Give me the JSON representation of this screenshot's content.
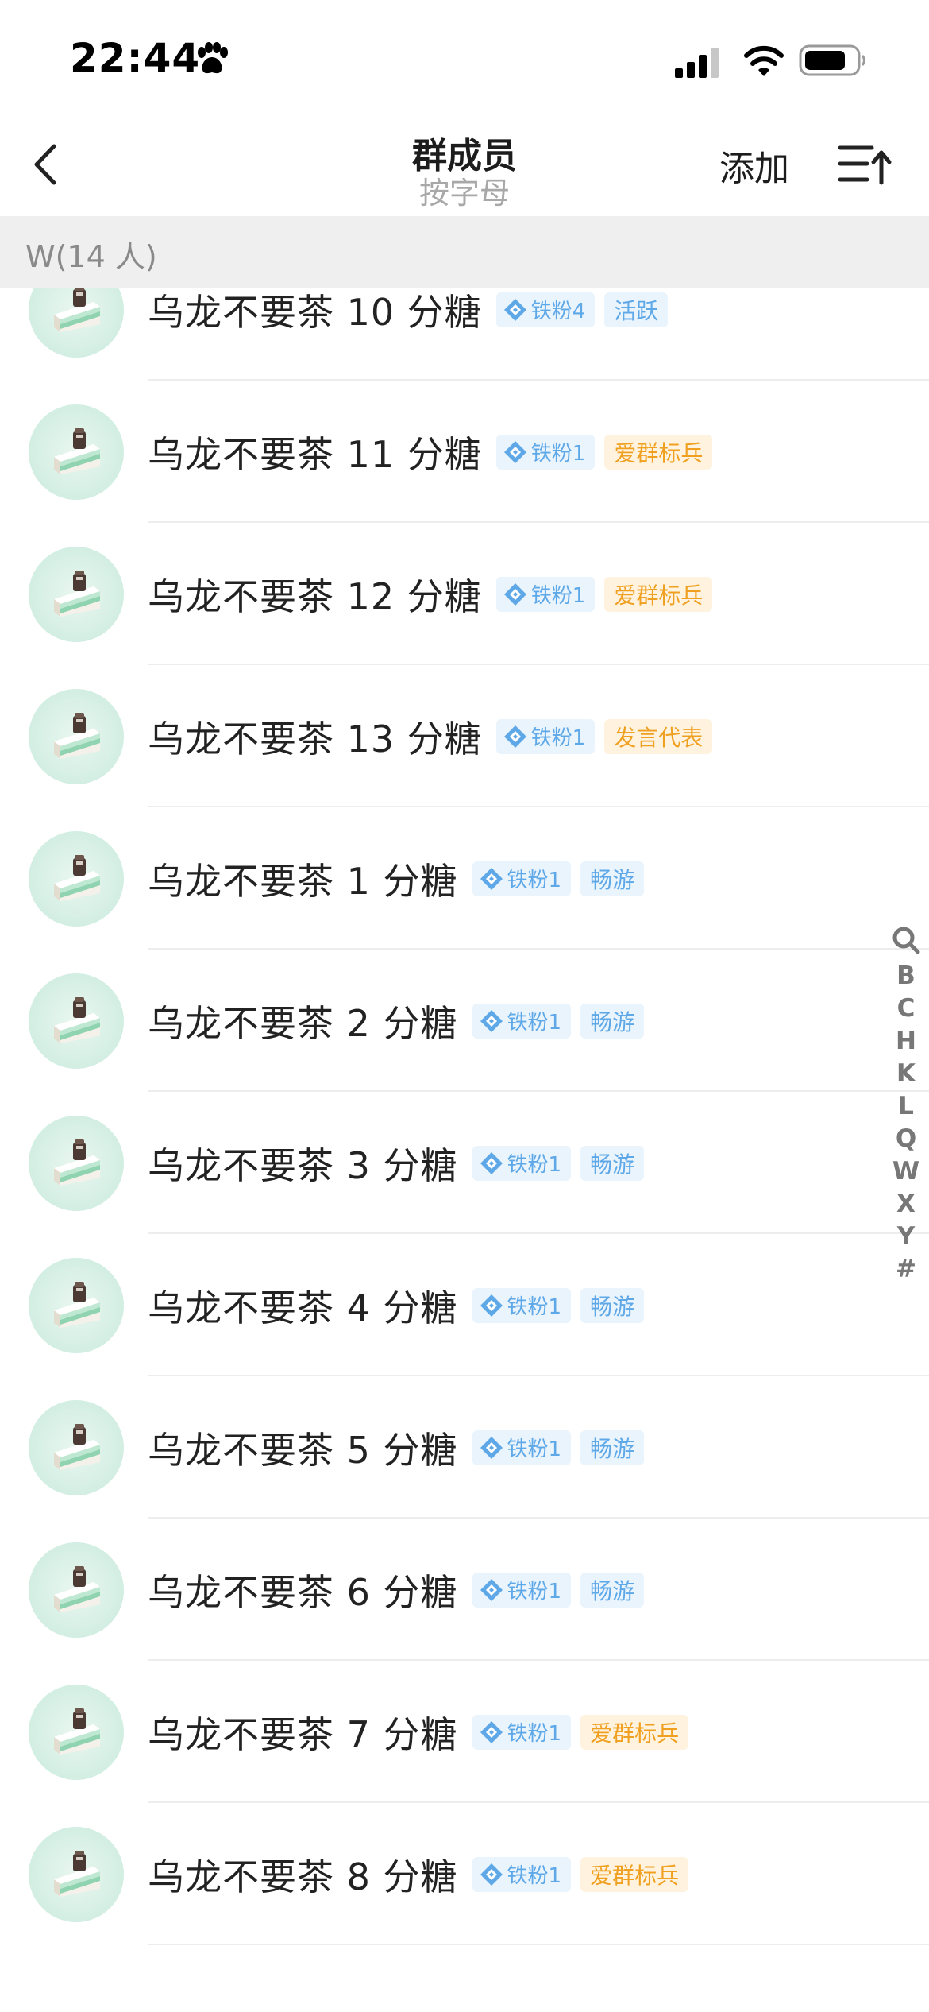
{
  "status_bar": {
    "time": "22:44"
  },
  "header": {
    "title": "群成员",
    "subtitle": "按字母",
    "add_label": "添加"
  },
  "section": {
    "label": "W(14 人)"
  },
  "members": [
    {
      "name": "乌龙不要茶 10 分糖",
      "fan_badge": "铁粉4",
      "role": "活跃",
      "role_color": "blue"
    },
    {
      "name": "乌龙不要茶 11 分糖",
      "fan_badge": "铁粉1",
      "role": "爱群标兵",
      "role_color": "orange"
    },
    {
      "name": "乌龙不要茶 12 分糖",
      "fan_badge": "铁粉1",
      "role": "爱群标兵",
      "role_color": "orange"
    },
    {
      "name": "乌龙不要茶 13 分糖",
      "fan_badge": "铁粉1",
      "role": "发言代表",
      "role_color": "orange"
    },
    {
      "name": "乌龙不要茶 1 分糖",
      "fan_badge": "铁粉1",
      "role": "畅游",
      "role_color": "blue"
    },
    {
      "name": "乌龙不要茶 2 分糖",
      "fan_badge": "铁粉1",
      "role": "畅游",
      "role_color": "blue"
    },
    {
      "name": "乌龙不要茶 3 分糖",
      "fan_badge": "铁粉1",
      "role": "畅游",
      "role_color": "blue"
    },
    {
      "name": "乌龙不要茶 4 分糖",
      "fan_badge": "铁粉1",
      "role": "畅游",
      "role_color": "blue"
    },
    {
      "name": "乌龙不要茶 5 分糖",
      "fan_badge": "铁粉1",
      "role": "畅游",
      "role_color": "blue"
    },
    {
      "name": "乌龙不要茶 6 分糖",
      "fan_badge": "铁粉1",
      "role": "畅游",
      "role_color": "blue"
    },
    {
      "name": "乌龙不要茶 7 分糖",
      "fan_badge": "铁粉1",
      "role": "爱群标兵",
      "role_color": "orange"
    },
    {
      "name": "乌龙不要茶 8 分糖",
      "fan_badge": "铁粉1",
      "role": "爱群标兵",
      "role_color": "orange"
    }
  ],
  "index_bar": {
    "letters": [
      "B",
      "C",
      "H",
      "K",
      "L",
      "Q",
      "W",
      "X",
      "Y",
      "#"
    ]
  },
  "colors": {
    "badge_blue_text": "#5ea8e8",
    "badge_blue_bg": "#eaf4fd",
    "badge_orange_text": "#f0a020",
    "badge_orange_bg": "#fff3e0",
    "section_bg": "#efefef"
  }
}
